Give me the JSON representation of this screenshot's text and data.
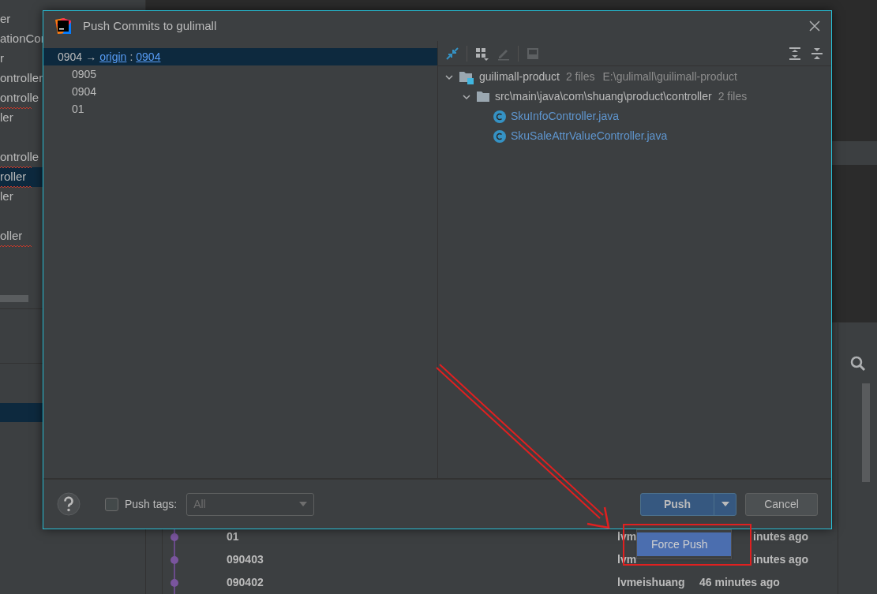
{
  "background": {
    "project_tree": [
      {
        "label": "er",
        "selected": false,
        "misspelled": false
      },
      {
        "label": "ationCor",
        "selected": false,
        "misspelled": false
      },
      {
        "label": "r",
        "selected": false,
        "misspelled": false
      },
      {
        "label": "ontroller",
        "selected": false,
        "misspelled": false
      },
      {
        "label": "ontrolle",
        "selected": false,
        "misspelled": true
      },
      {
        "label": "ler",
        "selected": false,
        "misspelled": false
      },
      {
        "selected": false
      },
      {
        "label": "ontrolle",
        "selected": false,
        "misspelled": true
      },
      {
        "label": "roller",
        "selected": true,
        "misspelled": true
      },
      {
        "label": "ler",
        "selected": false,
        "misspelled": false
      },
      {
        "selected": false
      },
      {
        "label": "oller",
        "selected": false,
        "misspelled": true
      }
    ],
    "log_rows": [
      {
        "subject": "01",
        "author": "lvm",
        "time": "inutes ago"
      },
      {
        "subject": "090403",
        "author": "lvm",
        "time": "inutes ago"
      },
      {
        "subject": "090402",
        "author": "lvmeishuang",
        "time": "46 minutes ago"
      }
    ]
  },
  "dialog": {
    "title": "Push Commits to gulimall",
    "push_target": {
      "local": "0904",
      "arrow": "→",
      "remote": "origin",
      "separator": ":",
      "branch": "0904",
      "selected": true
    },
    "commits": [
      "0905",
      "0904",
      "01"
    ],
    "tree": [
      {
        "label": "guilimall-product",
        "kind": "module",
        "count": "2 files",
        "path": "E:\\gulimall\\guilimall-product",
        "expanded": true,
        "children": [
          {
            "label": "src\\main\\java\\com\\shuang\\product\\controller",
            "kind": "folder",
            "count": "2 files",
            "expanded": true,
            "children": [
              {
                "label": "SkuInfoController.java",
                "kind": "class"
              },
              {
                "label": "SkuSaleAttrValueController.java",
                "kind": "class"
              }
            ]
          }
        ]
      }
    ],
    "push_tags": {
      "label": "Push tags:",
      "checked": false,
      "value": "All",
      "disabled": true
    },
    "buttons": [
      {
        "label": "Push",
        "kind": "primary"
      },
      {
        "label": "Cancel",
        "kind": "secondary"
      }
    ],
    "push_menu": [
      {
        "label": "Force Push",
        "selected": true
      }
    ]
  }
}
